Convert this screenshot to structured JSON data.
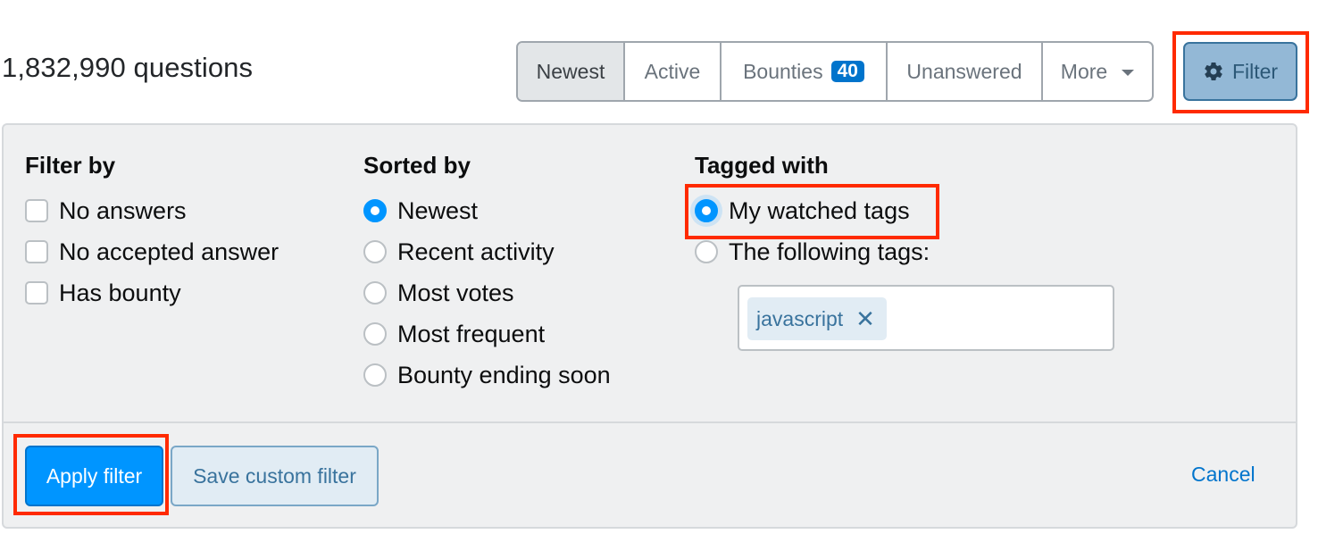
{
  "header": {
    "question_count": "1,832,990 questions"
  },
  "tabs": [
    {
      "label": "Newest",
      "active": true
    },
    {
      "label": "Active",
      "active": false
    },
    {
      "label": "Bounties",
      "badge": "40",
      "active": false
    },
    {
      "label": "Unanswered",
      "active": false
    },
    {
      "label": "More",
      "active": false
    }
  ],
  "filter_button": {
    "label": "Filter",
    "icon": "gear-icon"
  },
  "panel": {
    "filter_by": {
      "heading": "Filter by",
      "options": [
        {
          "label": "No answers",
          "checked": false
        },
        {
          "label": "No accepted answer",
          "checked": false
        },
        {
          "label": "Has bounty",
          "checked": false
        }
      ]
    },
    "sorted_by": {
      "heading": "Sorted by",
      "options": [
        {
          "label": "Newest",
          "selected": true
        },
        {
          "label": "Recent activity",
          "selected": false
        },
        {
          "label": "Most votes",
          "selected": false
        },
        {
          "label": "Most frequent",
          "selected": false
        },
        {
          "label": "Bounty ending soon",
          "selected": false
        }
      ]
    },
    "tagged_with": {
      "heading": "Tagged with",
      "options": [
        {
          "label": "My watched tags",
          "selected": true
        },
        {
          "label": "The following tags:",
          "selected": false
        }
      ],
      "tags": [
        "javascript"
      ],
      "remove_icon": "✕"
    },
    "actions": {
      "apply_label": "Apply filter",
      "save_label": "Save custom filter",
      "cancel_label": "Cancel"
    }
  },
  "colors": {
    "primary": "#0095ff",
    "link": "#0074cc",
    "highlight": "#ff2a00",
    "panel_bg": "#eff0f1",
    "tag_bg": "#e1ecf4"
  }
}
